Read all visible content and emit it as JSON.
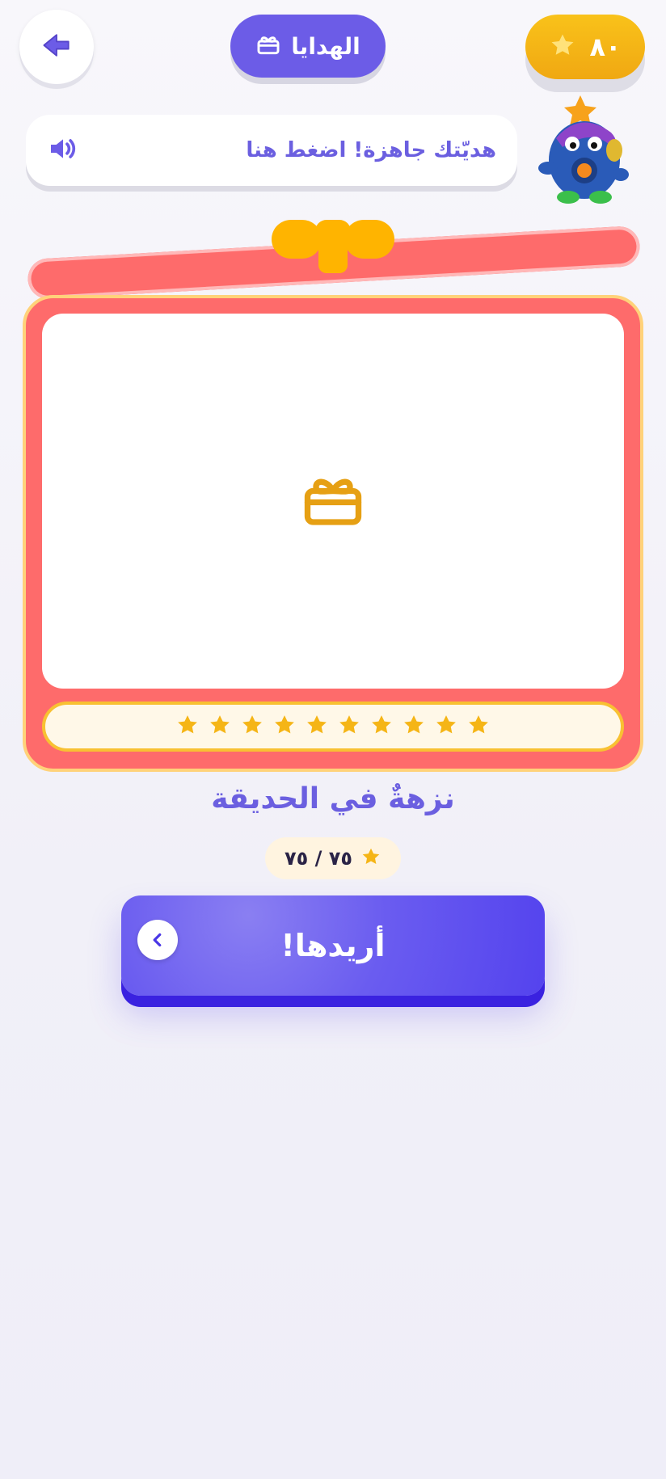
{
  "header": {
    "stars_count": "٨٠",
    "title": "الهدايا",
    "back_button_label": "",
    "colors": {
      "stars_pill": "#f5b516",
      "title_pill": "#6c5ce7"
    }
  },
  "speech_bubble": {
    "message": "هديّتك جاهزة! اضغط هنا",
    "audio_icon": "speaker-icon"
  },
  "mascot": {
    "icon": "monster-mascot"
  },
  "gift": {
    "icon": "gift-icon",
    "stars_in_strip": 10,
    "name": "نزهةٌ في الحديقة",
    "price_text": "٧٥ / ٧٥",
    "colors": {
      "box": "#fe6b6b",
      "bow": "#ffb400",
      "star": "#f5b516"
    }
  },
  "cta": {
    "label": "أريدها!",
    "icon": "chevron-left-icon",
    "color": "#5a49ef"
  }
}
